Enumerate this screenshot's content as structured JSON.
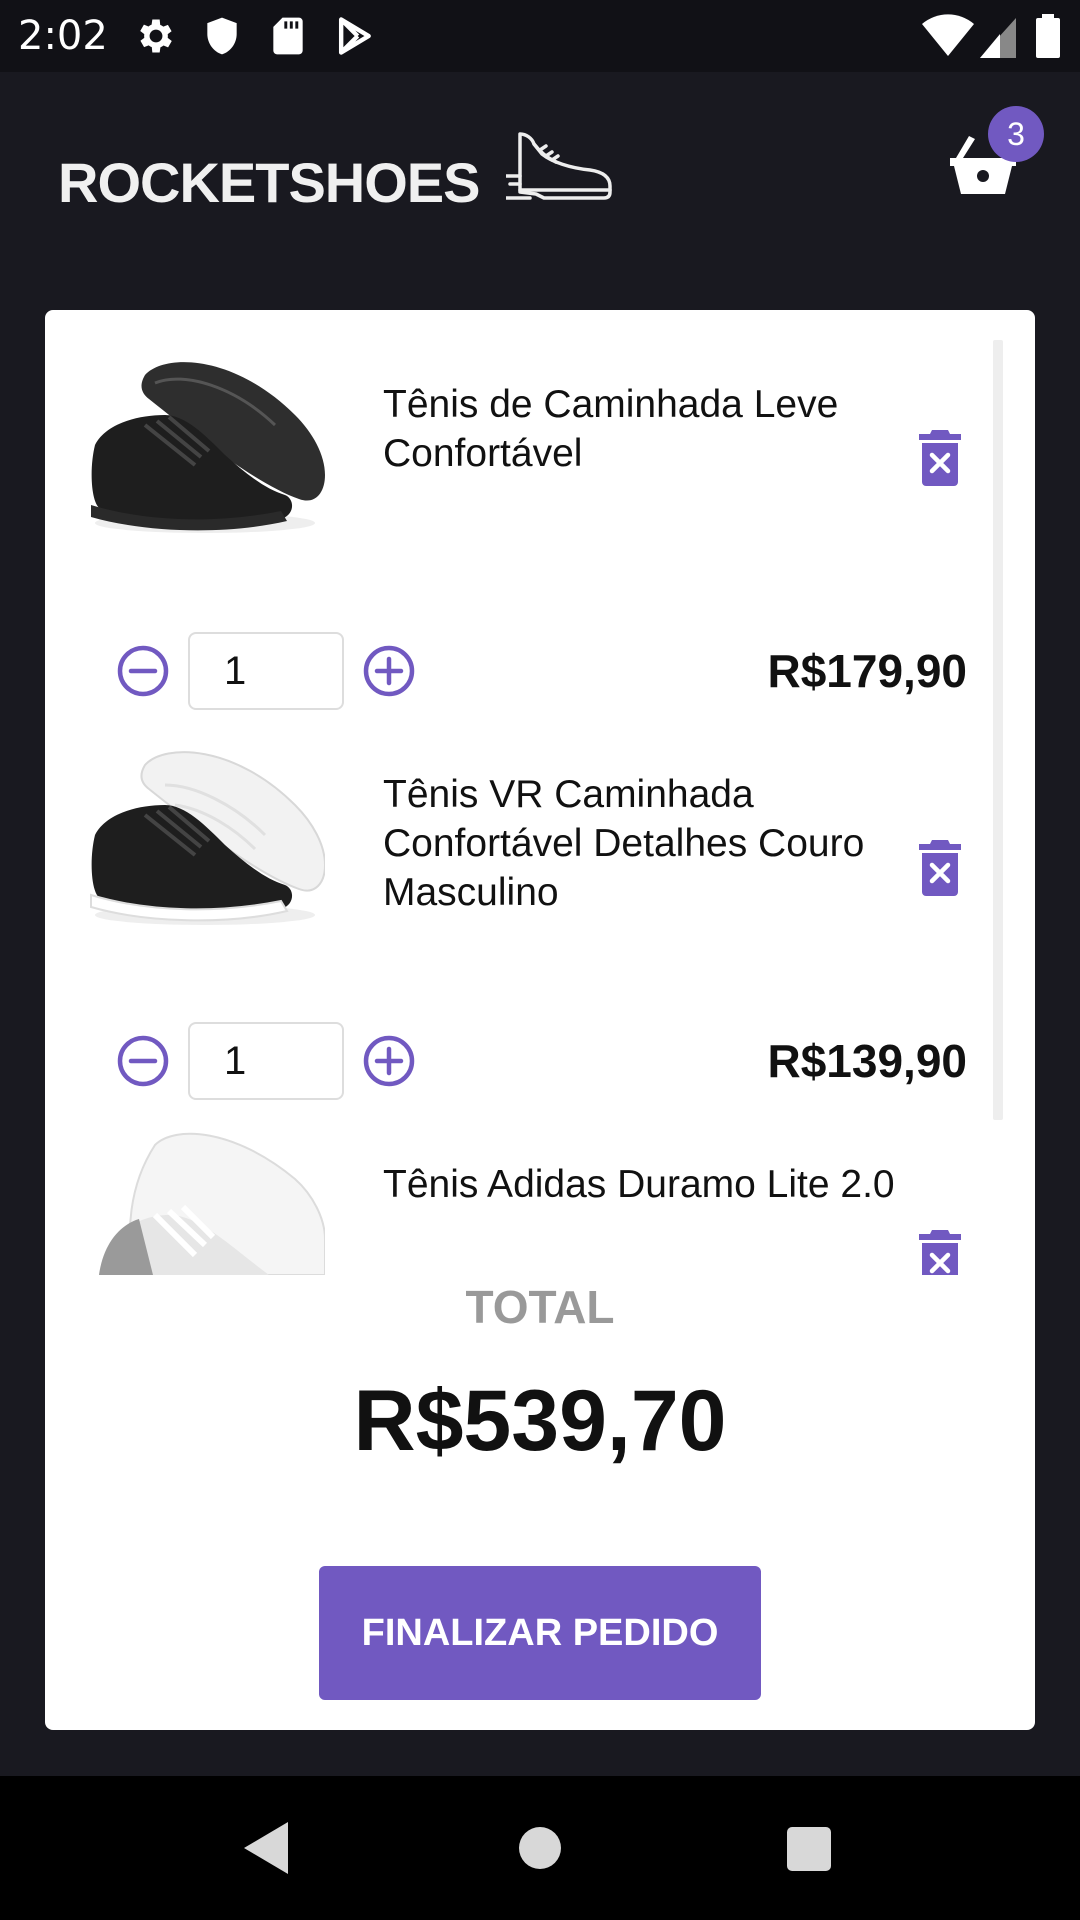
{
  "status_bar": {
    "time": "2:02"
  },
  "header": {
    "logo_text": "ROCKETSHOES",
    "cart_count": "3"
  },
  "cart": {
    "items": [
      {
        "title": "Tênis de Caminhada Leve Confortável",
        "quantity": "1",
        "price": "R$179,90",
        "shoe_color": "black"
      },
      {
        "title": "Tênis VR Caminhada Confortável Detalhes Couro Masculino",
        "quantity": "1",
        "price": "R$139,90",
        "shoe_color": "black-white"
      },
      {
        "title": "Tênis Adidas Duramo Lite 2.0",
        "shoe_color": "white"
      }
    ]
  },
  "total": {
    "label": "TOTAL",
    "value": "R$539,70"
  },
  "checkout_label": "FINALIZAR PEDIDO",
  "colors": {
    "accent": "#7159c1",
    "background": "#191920"
  }
}
